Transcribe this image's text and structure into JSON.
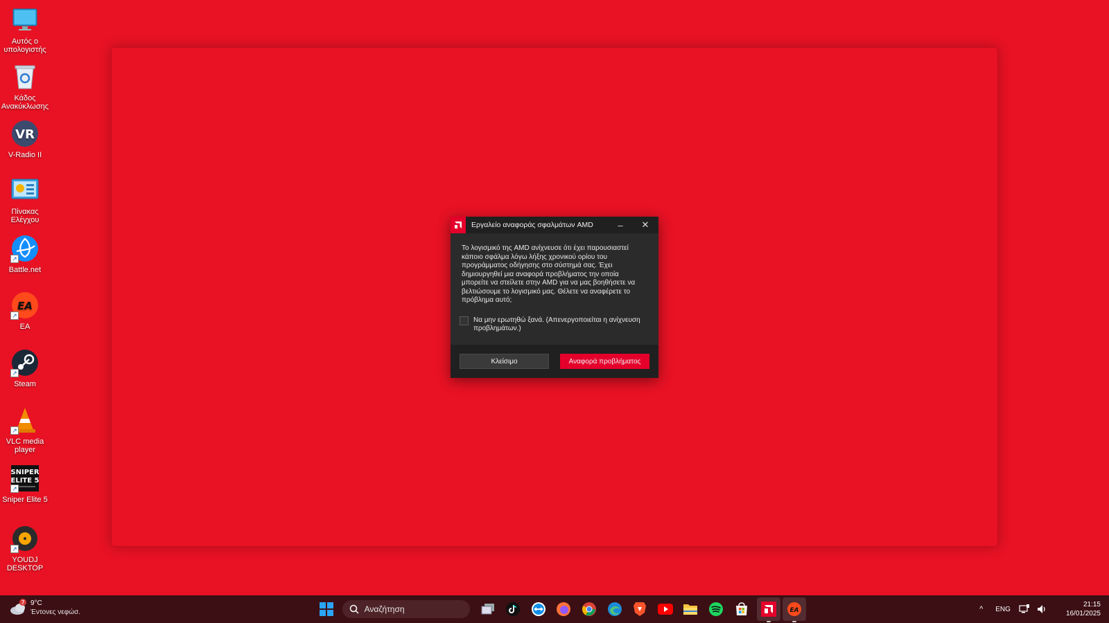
{
  "desktop": {
    "icons": [
      {
        "label": "Αυτός ο υπολογιστής",
        "icon": "monitor-icon"
      },
      {
        "label": "Κάδος Ανακύκλωσης",
        "icon": "recycle-bin-icon"
      },
      {
        "label": "V-Radio II",
        "icon": "vradio-icon"
      },
      {
        "label": "Πίνακας Ελέγχου",
        "icon": "control-panel-icon"
      },
      {
        "label": "Battle.net",
        "icon": "battlenet-icon"
      },
      {
        "label": "EA",
        "icon": "ea-icon"
      },
      {
        "label": "Steam",
        "icon": "steam-icon"
      },
      {
        "label": "VLC media player",
        "icon": "vlc-icon"
      },
      {
        "label": "Sniper Elite 5",
        "icon": "sniper-elite-icon"
      },
      {
        "label": "YOUDJ DESKTOP",
        "icon": "youdj-icon"
      }
    ],
    "sniper_logo_text": "SNIPER ELITE 5",
    "ea_logo_text": "EA"
  },
  "dialog": {
    "title": "Εργαλείο αναφοράς σφαλμάτων AMD",
    "message": "Το λογισμικό της AMD ανίχνευσε ότι έχει παρουσιαστεί κάποιο σφάλμα λόγω λήξης χρονικού ορίου του προγράμματος οδήγησης στο σύστημά σας. Έχει δημιουργηθεί μια αναφορά προβλήματος την οποία μπορείτε να στείλετε στην AMD για να μας βοηθήσετε να βελτιώσουμε το λογισμικό μας. Θέλετε να αναφέρετε το πρόβλημα αυτό;",
    "checkbox_label": "Να μην ερωτηθώ ξανά. (Απενεργοποιείται η ανίχνευση προβλημάτων.)",
    "checkbox_checked": false,
    "close_button": "Κλείσιμο",
    "report_button": "Αναφορά προβλήματος",
    "minimize_glyph": "–",
    "close_glyph": "✕",
    "accent_color": "#e4002b"
  },
  "taskbar": {
    "weather_temp": "9°C",
    "weather_desc": "Έντονες νεφώσ.",
    "weather_badge": "7",
    "search_placeholder": "Αναζήτηση",
    "apps": [
      "windows-start-icon",
      "task-view-icon",
      "tiktok-icon",
      "teamviewer-icon",
      "firefox-icon",
      "chrome-icon",
      "edge-icon",
      "brave-icon",
      "youtube-icon",
      "file-explorer-icon",
      "spotify-icon",
      "microsoft-store-icon",
      "amd-software-icon",
      "ea-app-icon"
    ],
    "tray_chevron": "^",
    "language": "ENG",
    "time": "21:15",
    "date": "16/01/2025"
  }
}
